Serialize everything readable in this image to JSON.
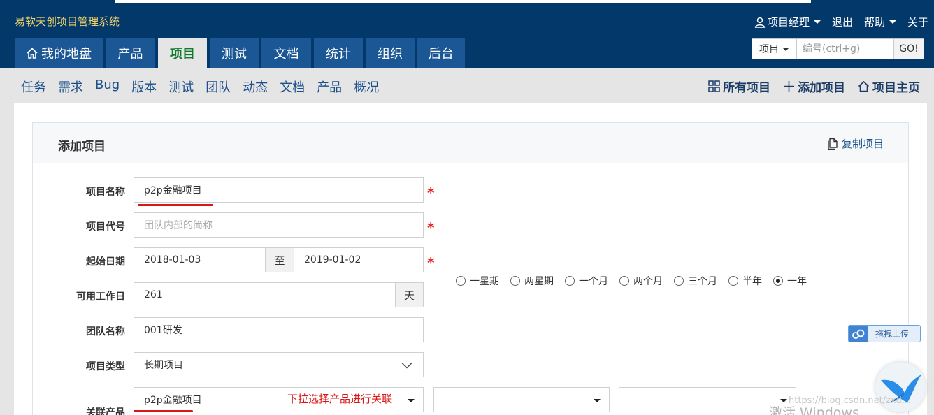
{
  "brand": "易软天创项目管理系统",
  "userbar": {
    "role": "项目经理",
    "logout": "退出",
    "help": "帮助",
    "about": "关于"
  },
  "mainnav": [
    {
      "label": "我的地盘",
      "icon": "home-icon"
    },
    {
      "label": "产品"
    },
    {
      "label": "项目",
      "active": true
    },
    {
      "label": "测试"
    },
    {
      "label": "文档"
    },
    {
      "label": "统计"
    },
    {
      "label": "组织"
    },
    {
      "label": "后台"
    }
  ],
  "search": {
    "scope": "项目",
    "placeholder": "编号(ctrl+g)",
    "go": "GO!"
  },
  "subnav": {
    "items": [
      "任务",
      "需求",
      "Bug",
      "版本",
      "测试",
      "团队",
      "动态",
      "文档",
      "产品",
      "概况"
    ],
    "actions": {
      "all": "所有项目",
      "add": "添加项目",
      "home": "项目主页"
    }
  },
  "panel": {
    "title": "添加项目",
    "copy": "复制项目"
  },
  "form": {
    "name": {
      "label": "项目名称",
      "value": "p2p金融项目"
    },
    "code": {
      "label": "项目代号",
      "placeholder": "团队内部的简称"
    },
    "date": {
      "label": "起始日期",
      "begin": "2018-01-03",
      "sep": "至",
      "end": "2019-01-02"
    },
    "durations": [
      {
        "label": "一星期",
        "checked": false
      },
      {
        "label": "两星期",
        "checked": false
      },
      {
        "label": "一个月",
        "checked": false
      },
      {
        "label": "两个月",
        "checked": false
      },
      {
        "label": "三个月",
        "checked": false
      },
      {
        "label": "半年",
        "checked": false
      },
      {
        "label": "一年",
        "checked": true
      }
    ],
    "days": {
      "label": "可用工作日",
      "value": "261",
      "unit": "天"
    },
    "team": {
      "label": "团队名称",
      "value": "001研发"
    },
    "type": {
      "label": "项目类型",
      "value": "长期项目"
    },
    "products": {
      "label": "关联产品",
      "value": "p2p金融项目",
      "note": "下拉选择产品进行关联"
    },
    "required": "*"
  },
  "upload": {
    "label": "拖拽上传"
  },
  "watermark": "https://blog.csdn.net/zxd...",
  "winmark": "激活 Windows"
}
